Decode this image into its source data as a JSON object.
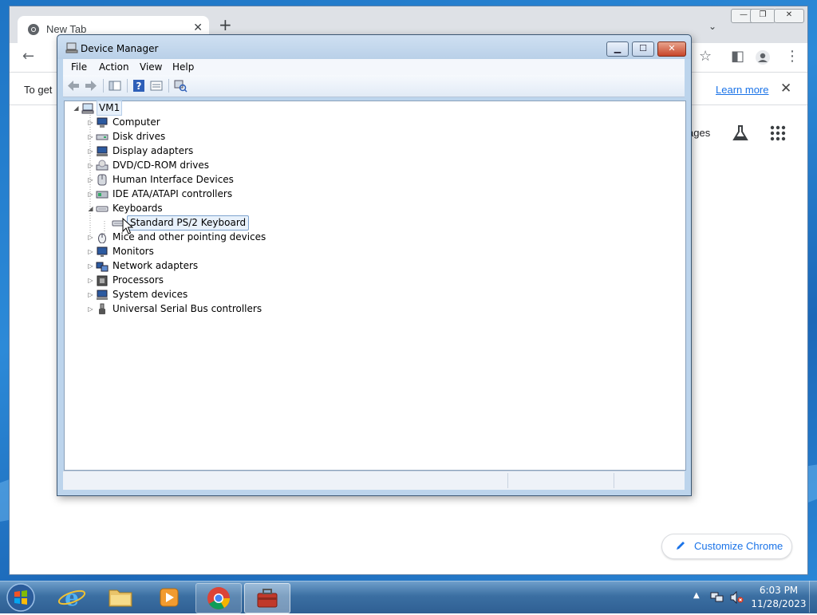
{
  "chrome": {
    "tab_title": "New Tab",
    "info_text": "To get",
    "learn_more": "Learn more",
    "images_link": "ages",
    "customize_label": "Customize Chrome"
  },
  "device_manager": {
    "title": "Device Manager",
    "menu": [
      "File",
      "Action",
      "View",
      "Help"
    ],
    "root": "VM1",
    "nodes": [
      {
        "label": "Computer",
        "icon": "computer-icon",
        "expanded": false
      },
      {
        "label": "Disk drives",
        "icon": "disk-drive-icon",
        "expanded": false
      },
      {
        "label": "Display adapters",
        "icon": "display-adapter-icon",
        "expanded": false
      },
      {
        "label": "DVD/CD-ROM drives",
        "icon": "dvd-drive-icon",
        "expanded": false
      },
      {
        "label": "Human Interface Devices",
        "icon": "hid-icon",
        "expanded": false
      },
      {
        "label": "IDE ATA/ATAPI controllers",
        "icon": "ide-controller-icon",
        "expanded": false
      },
      {
        "label": "Keyboards",
        "icon": "keyboard-icon",
        "expanded": true
      },
      {
        "label": "Standard PS/2 Keyboard",
        "icon": "keyboard-icon",
        "child": true,
        "selected": true
      },
      {
        "label": "Mice and other pointing devices",
        "icon": "mouse-icon",
        "expanded": false
      },
      {
        "label": "Monitors",
        "icon": "monitor-icon",
        "expanded": false
      },
      {
        "label": "Network adapters",
        "icon": "network-adapter-icon",
        "expanded": false
      },
      {
        "label": "Processors",
        "icon": "processor-icon",
        "expanded": false
      },
      {
        "label": "System devices",
        "icon": "system-device-icon",
        "expanded": false
      },
      {
        "label": "Universal Serial Bus controllers",
        "icon": "usb-icon",
        "expanded": false
      }
    ]
  },
  "taskbar": {
    "time": "6:03 PM",
    "date": "11/28/2023"
  },
  "colors": {
    "accent_blue": "#1a73e8",
    "desktop_blue": "#1e74c4",
    "selection_border": "#7da2ce"
  }
}
